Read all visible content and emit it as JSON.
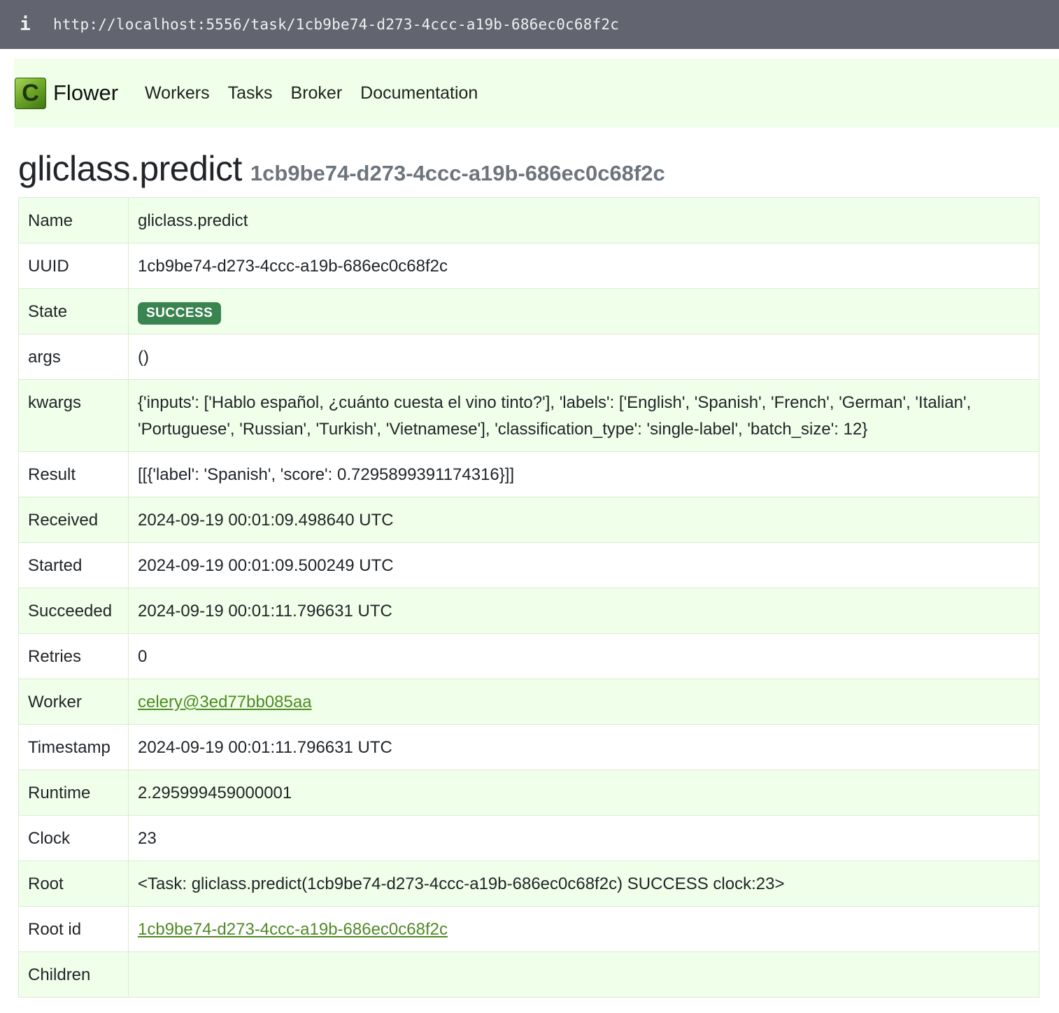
{
  "browser": {
    "url": "http://localhost:5556/task/1cb9be74-d273-4ccc-a19b-686ec0c68f2c",
    "info_icon": "i"
  },
  "navbar": {
    "brand_letter": "C",
    "brand": "Flower",
    "links": [
      "Workers",
      "Tasks",
      "Broker",
      "Documentation"
    ]
  },
  "header": {
    "task_name": "gliclass.predict",
    "task_uuid": "1cb9be74-d273-4ccc-a19b-686ec0c68f2c"
  },
  "details": {
    "name": {
      "label": "Name",
      "value": "gliclass.predict"
    },
    "uuid": {
      "label": "UUID",
      "value": "1cb9be74-d273-4ccc-a19b-686ec0c68f2c"
    },
    "state": {
      "label": "State",
      "value": "SUCCESS",
      "color": "#3a8451"
    },
    "args": {
      "label": "args",
      "value": "()"
    },
    "kwargs": {
      "label": "kwargs",
      "value": "{'inputs': ['Hablo español, ¿cuánto cuesta el vino tinto?'], 'labels': ['English', 'Spanish', 'French', 'German', 'Italian', 'Portuguese', 'Russian', 'Turkish', 'Vietnamese'], 'classification_type': 'single-label', 'batch_size': 12}"
    },
    "result": {
      "label": "Result",
      "value": "[[{'label': 'Spanish', 'score': 0.7295899391174316}]]"
    },
    "received": {
      "label": "Received",
      "value": "2024-09-19 00:01:09.498640 UTC"
    },
    "started": {
      "label": "Started",
      "value": "2024-09-19 00:01:09.500249 UTC"
    },
    "succeeded": {
      "label": "Succeeded",
      "value": "2024-09-19 00:01:11.796631 UTC"
    },
    "retries": {
      "label": "Retries",
      "value": "0"
    },
    "worker": {
      "label": "Worker",
      "value": "celery@3ed77bb085aa"
    },
    "timestamp": {
      "label": "Timestamp",
      "value": "2024-09-19 00:01:11.796631 UTC"
    },
    "runtime": {
      "label": "Runtime",
      "value": "2.295999459000001"
    },
    "clock": {
      "label": "Clock",
      "value": "23"
    },
    "root": {
      "label": "Root",
      "value": "<Task: gliclass.predict(1cb9be74-d273-4ccc-a19b-686ec0c68f2c) SUCCESS clock:23>"
    },
    "root_id": {
      "label": "Root id",
      "value": "1cb9be74-d273-4ccc-a19b-686ec0c68f2c"
    },
    "children": {
      "label": "Children",
      "value": ""
    }
  }
}
